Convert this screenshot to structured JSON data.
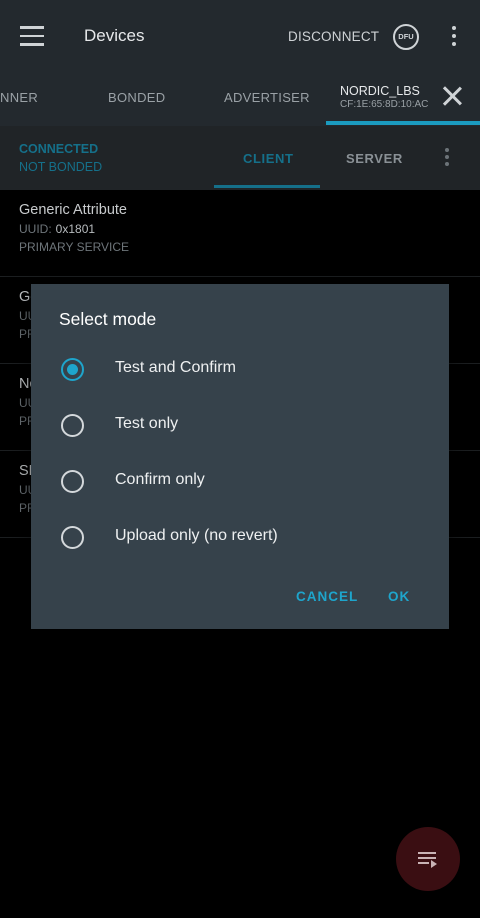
{
  "appbar": {
    "title": "Devices",
    "disconnect_label": "DISCONNECT",
    "dfu_label": "DFU"
  },
  "tabs": {
    "items": [
      "NNER",
      "BONDED",
      "ADVERTISER"
    ],
    "active": {
      "name": "NORDIC_LBS",
      "address": "CF:1E:65:8D:10:AC"
    }
  },
  "connection": {
    "status": "CONNECTED",
    "bond": "NOT BONDED",
    "client_tab": "CLIENT",
    "server_tab": "SERVER"
  },
  "services": [
    {
      "name": "Generic Attribute",
      "uuid_label": "UUID:",
      "uuid": "0x1801",
      "type": "PRIMARY SERVICE"
    },
    {
      "name": "Ge",
      "uuid_label": "UU",
      "uuid": "",
      "type": "PR"
    },
    {
      "name": "No",
      "uuid_label": "UU",
      "uuid": "",
      "type": "PR"
    },
    {
      "name": "SM",
      "uuid_label": "UU",
      "uuid": "",
      "type": "PR"
    }
  ],
  "dialog": {
    "title": "Select mode",
    "options": [
      "Test and Confirm",
      "Test only",
      "Confirm only",
      "Upload only (no revert)"
    ],
    "selected_index": 0,
    "cancel_label": "CANCEL",
    "ok_label": "OK"
  },
  "colors": {
    "accent": "#1ea5cc",
    "appbar": "#23292e",
    "dialog": "#36424b",
    "fab": "#3a0e12"
  },
  "fab": {
    "icon": "playlist-play-icon"
  }
}
